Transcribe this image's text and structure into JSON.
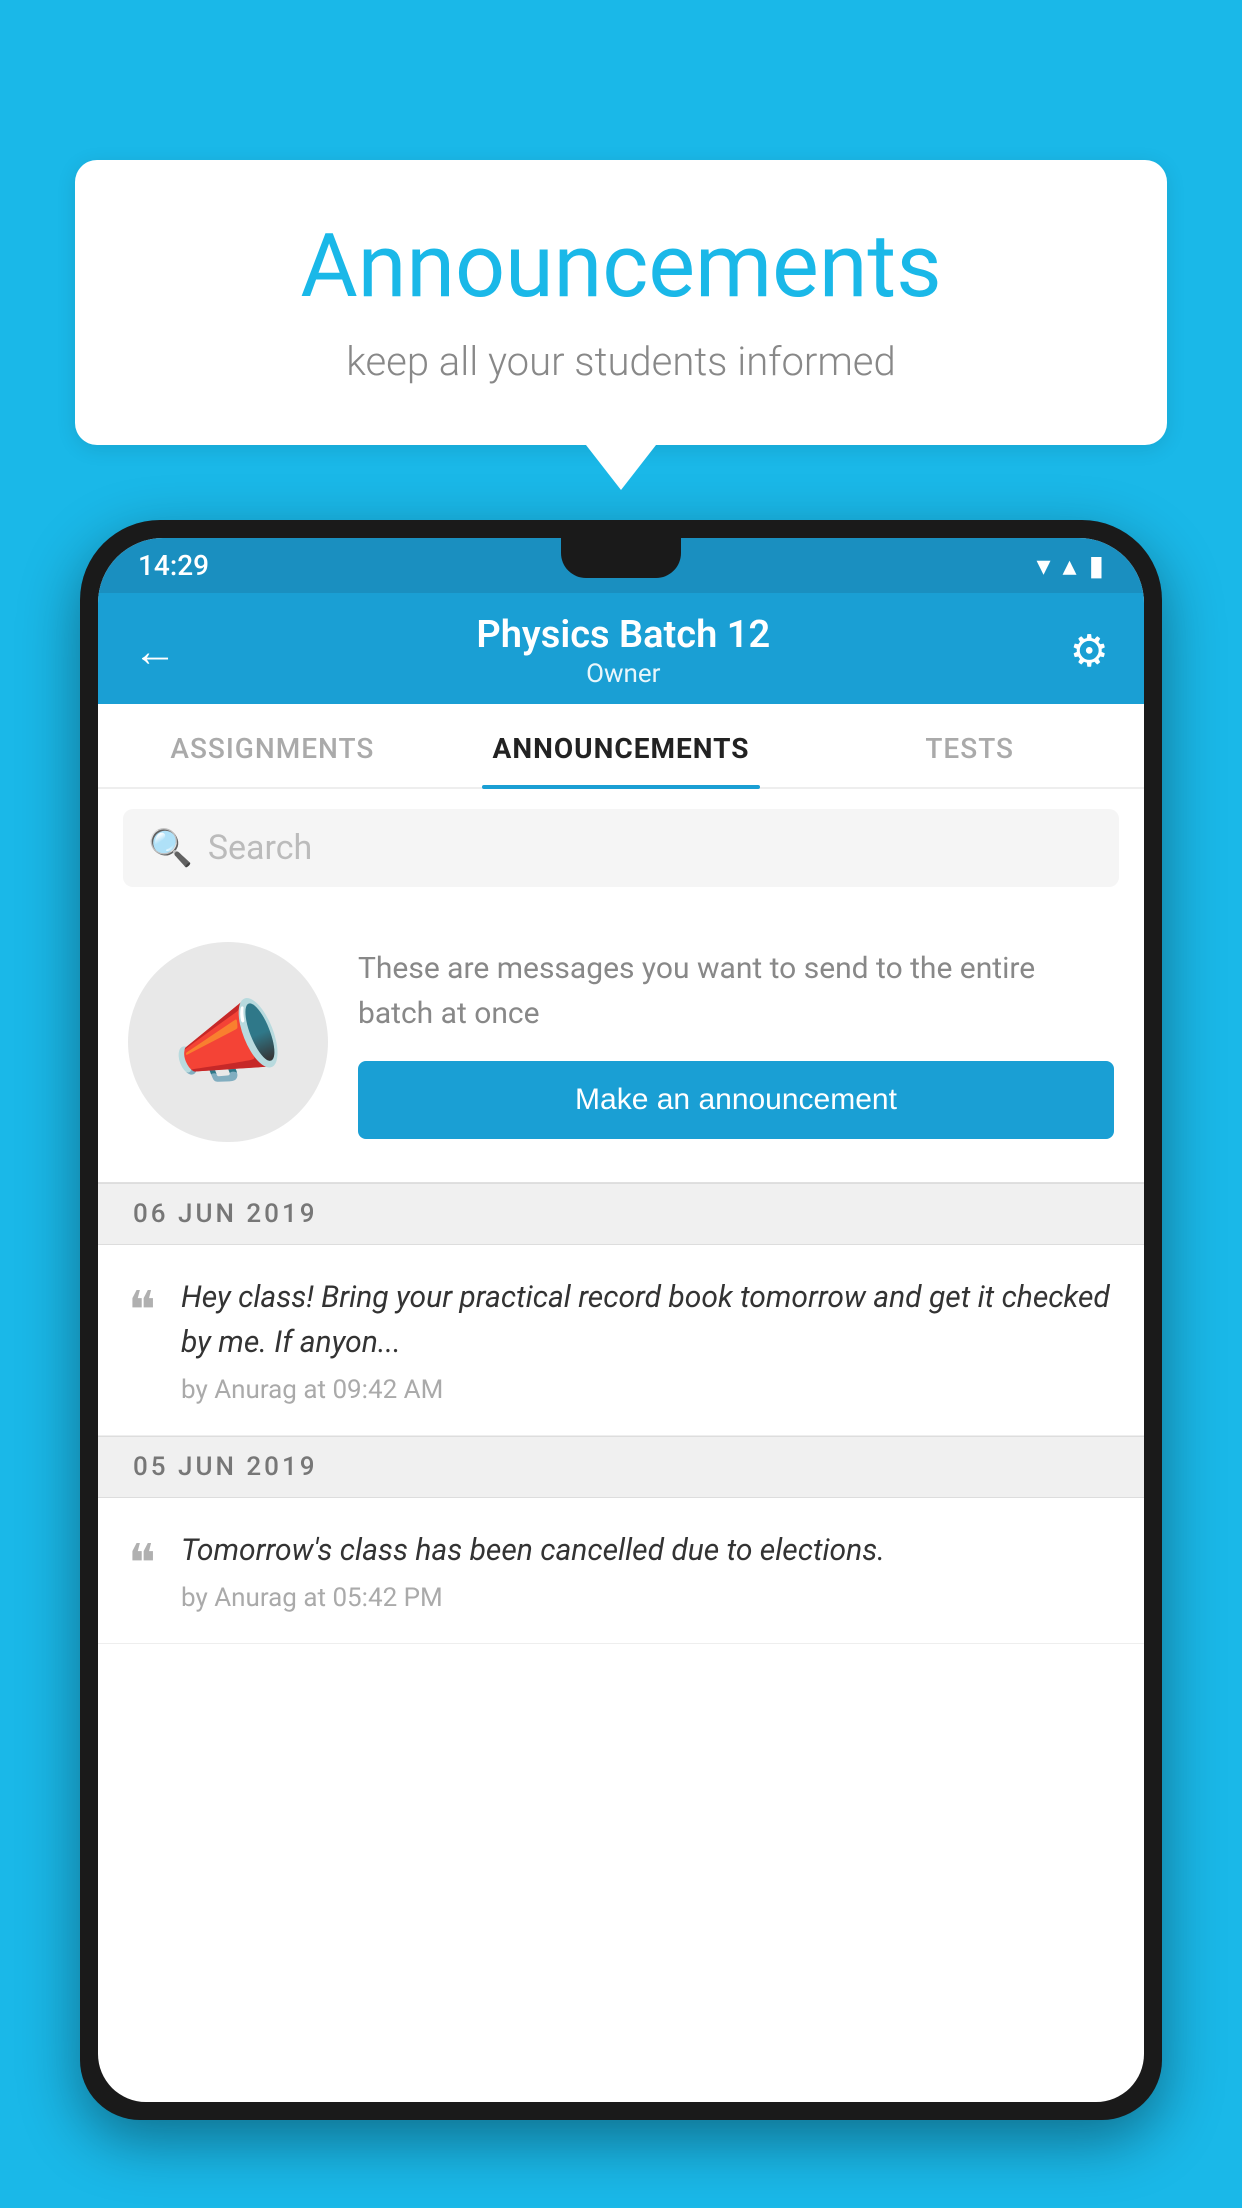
{
  "background_color": "#1ab8e8",
  "speech_bubble": {
    "title": "Announcements",
    "subtitle": "keep all your students informed"
  },
  "phone": {
    "status_bar": {
      "time": "14:29",
      "icons": [
        "wifi",
        "signal",
        "battery"
      ]
    },
    "header": {
      "title": "Physics Batch 12",
      "subtitle": "Owner",
      "back_label": "←",
      "settings_label": "⚙"
    },
    "tabs": [
      {
        "label": "ASSIGNMENTS",
        "active": false
      },
      {
        "label": "ANNOUNCEMENTS",
        "active": true
      },
      {
        "label": "TESTS",
        "active": false
      }
    ],
    "search": {
      "placeholder": "Search"
    },
    "promo": {
      "description": "These are messages you want to send to the entire batch at once",
      "button_label": "Make an announcement"
    },
    "announcements": [
      {
        "date": "06  JUN  2019",
        "text": "Hey class! Bring your practical record book tomorrow and get it checked by me. If anyon...",
        "meta": "by Anurag at 09:42 AM"
      },
      {
        "date": "05  JUN  2019",
        "text": "Tomorrow's class has been cancelled due to elections.",
        "meta": "by Anurag at 05:42 PM"
      }
    ]
  }
}
